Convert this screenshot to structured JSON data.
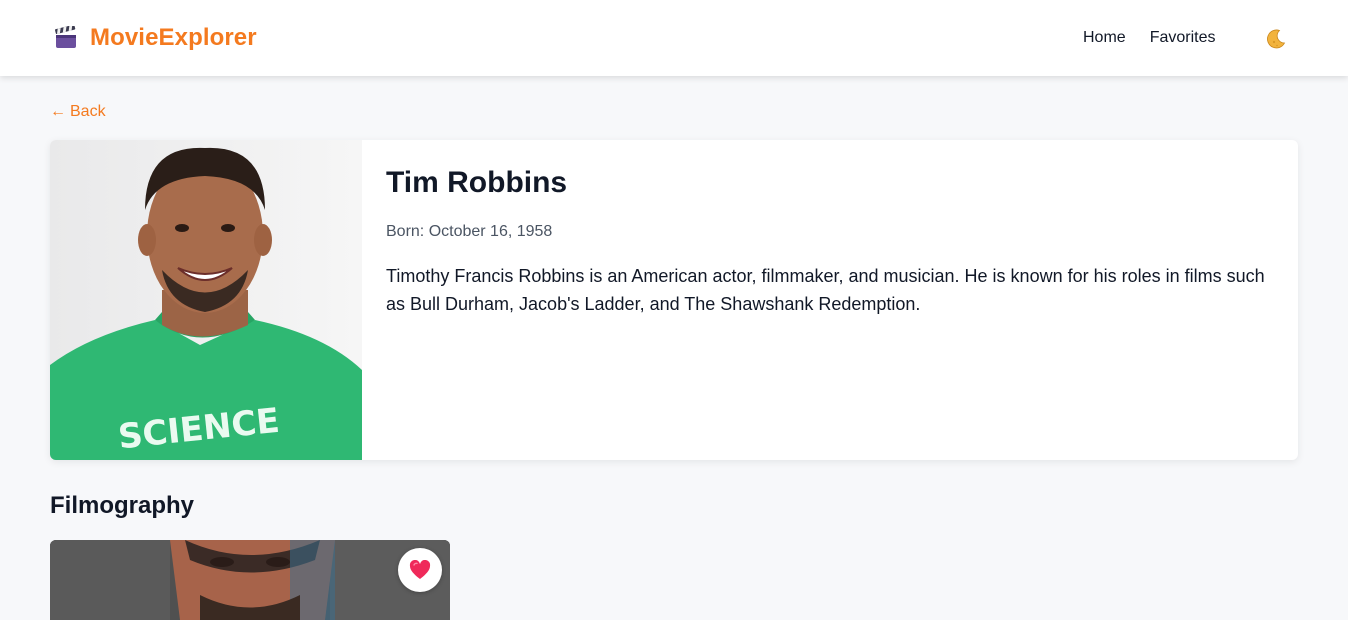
{
  "header": {
    "brand_name": "MovieExplorer",
    "brand_icon": "clapperboard-icon",
    "nav": {
      "home": "Home",
      "favorites": "Favorites"
    },
    "theme_toggle_icon": "moon-icon"
  },
  "back": {
    "arrow": "←",
    "label": "Back"
  },
  "actor": {
    "name": "Tim Robbins",
    "born": "Born: October 16, 1958",
    "bio": "Timothy Francis Robbins is an American actor, filmmaker, and musician. He is known for his roles in films such as Bull Durham, Jacob's Ladder, and The Shawshank Redemption."
  },
  "filmography": {
    "title": "Filmography",
    "items": [
      {
        "favorite_icon": "heart-icon",
        "favorited": true
      }
    ]
  },
  "colors": {
    "accent": "#f47a1f",
    "background": "#f7f8fa",
    "text": "#111827",
    "muted_text": "#4b5563",
    "heart": "#ef2a5a"
  }
}
